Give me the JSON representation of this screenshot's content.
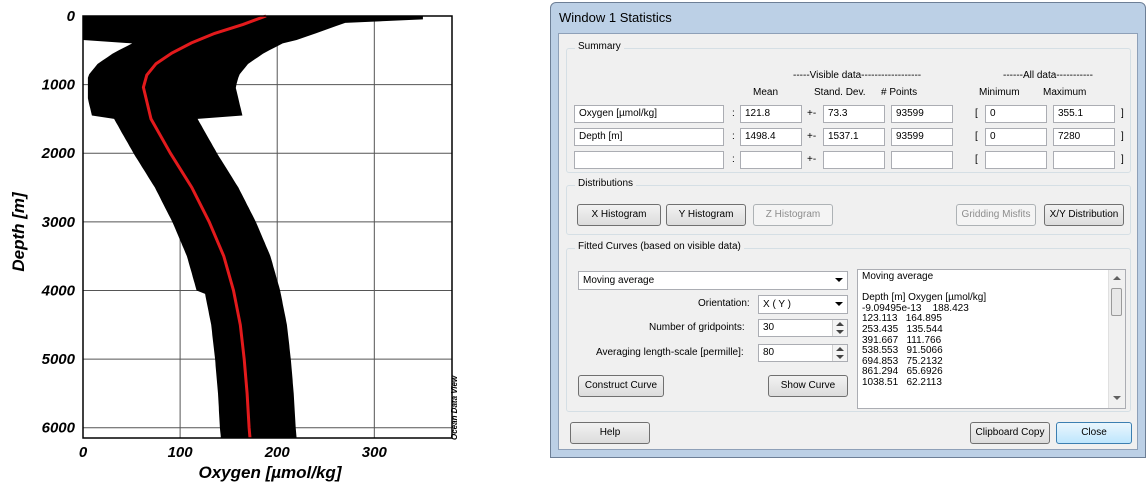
{
  "plot": {
    "y_ticks": [
      "0",
      "1000",
      "2000",
      "3000",
      "4000",
      "5000",
      "6000"
    ],
    "x_ticks": [
      "0",
      "100",
      "200",
      "300"
    ],
    "ylabel": "Depth [m]",
    "xlabel": "Oxygen [µmol/kg]",
    "watermark": "Ocean Data View",
    "colors": {
      "points": "#000000",
      "curve": "#e31a1c",
      "grid": "#555555"
    }
  },
  "chart_data": {
    "type": "scatter",
    "xlabel": "Oxygen [µmol/kg]",
    "ylabel": "Depth [m]",
    "xlim": [
      0,
      380
    ],
    "ylim": [
      6150,
      0
    ],
    "y_inverted": true,
    "grid": true,
    "x_ticks": [
      0,
      100,
      200,
      300
    ],
    "y_ticks": [
      0,
      1000,
      2000,
      3000,
      4000,
      5000,
      6000
    ],
    "fitted_curve": {
      "name": "Moving average",
      "depth": [
        0,
        123.113,
        253.435,
        391.667,
        538.553,
        694.853,
        861.294,
        1038.51,
        1500,
        2000,
        2500,
        3000,
        3500,
        4000,
        4500,
        5000,
        5500,
        6000,
        6150
      ],
      "oxygen": [
        188.423,
        164.895,
        135.544,
        111.766,
        91.5066,
        75.2132,
        65.6926,
        62.2113,
        70,
        90,
        112,
        130,
        145,
        155,
        162,
        166,
        169,
        171,
        172
      ]
    }
  },
  "window": {
    "title": "Window 1 Statistics",
    "summary": {
      "group_title": "Summary",
      "visible_header": "-----Visible data------------------",
      "all_header": "------All data-----------",
      "col_mean": "Mean",
      "col_std": "Stand. Dev.",
      "col_points": "# Points",
      "col_min": "Minimum",
      "col_max": "Maximum",
      "colon": ":",
      "plusminus": "+-",
      "lbracket": "[",
      "rbracket": "]",
      "rows": [
        {
          "name": "Oxygen [µmol/kg]",
          "mean": "121.8",
          "std": "73.3",
          "points": "93599",
          "min": "0",
          "max": "355.1"
        },
        {
          "name": "Depth [m]",
          "mean": "1498.4",
          "std": "1537.1",
          "points": "93599",
          "min": "0",
          "max": "7280"
        },
        {
          "name": "",
          "mean": "",
          "std": "",
          "points": "",
          "min": "",
          "max": ""
        }
      ]
    },
    "distributions": {
      "group_title": "Distributions",
      "x_hist": "X Histogram",
      "y_hist": "Y Histogram",
      "z_hist": "Z Histogram",
      "gridding": "Gridding Misfits",
      "xy_dist": "X/Y Distribution"
    },
    "fitted": {
      "group_title": "Fitted Curves (based on visible data)",
      "method": "Moving average",
      "orientation_label": "Orientation:",
      "orientation_value": "X ( Y )",
      "gridpoints_label": "Number of gridpoints:",
      "gridpoints_value": "30",
      "scale_label": "Averaging length-scale [permille]:",
      "scale_value": "80",
      "construct": "Construct Curve",
      "show": "Show Curve",
      "output": "Moving average\n\nDepth [m] Oxygen [µmol/kg]\n-9.09495e-13    188.423\n123.113   164.895\n253.435   135.544\n391.667   111.766\n538.553   91.5066\n694.853   75.2132\n861.294   65.6926\n1038.51   62.2113"
    },
    "footer": {
      "help": "Help",
      "clipboard": "Clipboard Copy",
      "close": "Close"
    }
  }
}
